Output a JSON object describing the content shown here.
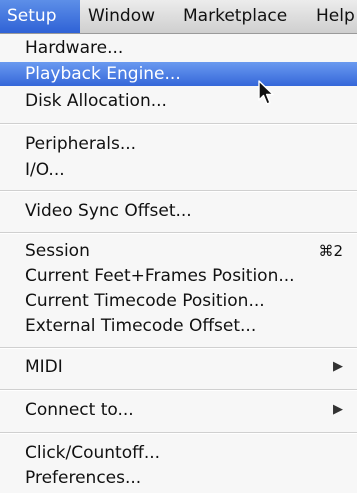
{
  "menubar": {
    "items": [
      {
        "label": "Setup",
        "active": true
      },
      {
        "label": "Window",
        "active": false
      },
      {
        "label": "Marketplace",
        "active": false
      },
      {
        "label": "Help",
        "active": false
      }
    ]
  },
  "menu": {
    "hardware": "Hardware...",
    "playback_engine": "Playback Engine...",
    "disk_allocation": "Disk Allocation...",
    "peripherals": "Peripherals...",
    "io": "I/O...",
    "video_sync_offset": "Video Sync Offset...",
    "session": "Session",
    "session_shortcut": "⌘2",
    "current_feet_frames": "Current Feet+Frames Position...",
    "current_timecode": "Current Timecode Position...",
    "external_timecode": "External Timecode Offset...",
    "midi": "MIDI",
    "connect_to": "Connect to...",
    "click_countoff": "Click/Countoff...",
    "preferences": "Preferences...",
    "submenu_arrow": "▶"
  },
  "colors": {
    "highlight": "#3567d9",
    "menu_bg": "#f7f7f7"
  },
  "icons": {
    "cursor": "arrow-cursor-icon",
    "submenu": "submenu-arrow-icon"
  }
}
